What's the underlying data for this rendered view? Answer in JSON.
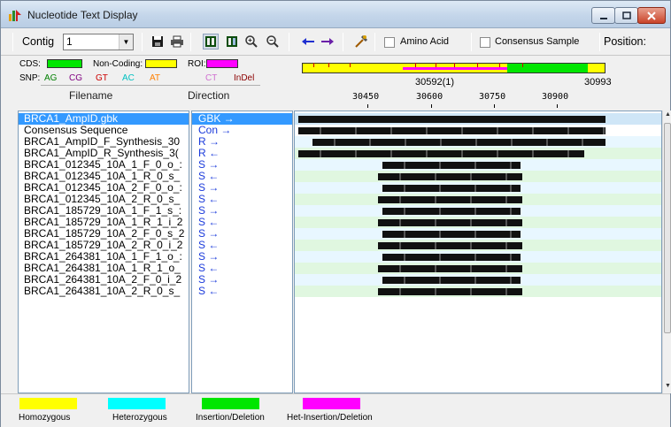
{
  "window": {
    "title": "Nucleotide Text Display"
  },
  "toolbar": {
    "contig_label": "Contig",
    "contig_value": "1",
    "amino_acid_label": "Amino Acid",
    "consensus_sample_label": "Consensus Sample",
    "position_label": "Position:",
    "icons": [
      "save-icon",
      "print-icon",
      "layout-1-icon",
      "layout-2-icon",
      "zoom-in-icon",
      "zoom-out-icon",
      "arrow-left-icon",
      "arrow-right-icon",
      "tools-icon"
    ]
  },
  "legend": {
    "cds_label": "CDS:",
    "noncoding_label": "Non-Coding:",
    "roi_label": "ROI:",
    "snp_label": "SNP:",
    "snp_types": [
      {
        "label": "AG",
        "color": "#008000"
      },
      {
        "label": "CG",
        "color": "#800080"
      },
      {
        "label": "GT",
        "color": "#cc0000"
      },
      {
        "label": "AC",
        "color": "#00c0c0"
      },
      {
        "label": "AT",
        "color": "#ff8000"
      },
      {
        "label": "CT",
        "color": "#d070d0"
      },
      {
        "label": "InDel",
        "color": "#8b0000"
      }
    ],
    "colors": {
      "cds": "#00e600",
      "noncoding": "#ffff00",
      "roi": "#ff00ff"
    }
  },
  "overview": {
    "center_label": "30592(1)",
    "end_label": "30993"
  },
  "columns": {
    "filename": "Filename",
    "direction": "Direction"
  },
  "ruler": [
    "30450",
    "30600",
    "30750",
    "30900"
  ],
  "files": [
    {
      "name": "BRCA1_AmpID.gbk",
      "direction": "GBK  →",
      "selected": true
    },
    {
      "name": "Consensus Sequence",
      "direction": "Con  →"
    },
    {
      "name": "BRCA1_AmpID_F_Synthesis_30",
      "direction": "R   →"
    },
    {
      "name": "BRCA1_AmpID_R_Synthesis_3(",
      "direction": "R   ←"
    },
    {
      "name": "BRCA1_012345_10A_1_F_0_o_:",
      "direction": "S   →"
    },
    {
      "name": "BRCA1_012345_10A_1_R_0_s_",
      "direction": "S   ←"
    },
    {
      "name": "BRCA1_012345_10A_2_F_0_o_:",
      "direction": "S   →"
    },
    {
      "name": "BRCA1_012345_10A_2_R_0_s_",
      "direction": "S   ←"
    },
    {
      "name": "BRCA1_185729_10A_1_F_1_s_:",
      "direction": "S   →"
    },
    {
      "name": "BRCA1_185729_10A_1_R_1_i_2",
      "direction": "S   ←"
    },
    {
      "name": "BRCA1_185729_10A_2_F_0_s_2",
      "direction": "S   →"
    },
    {
      "name": "BRCA1_185729_10A_2_R_0_i_2",
      "direction": "S   ←"
    },
    {
      "name": "BRCA1_264381_10A_1_F_1_o_:",
      "direction": "S   →"
    },
    {
      "name": "BRCA1_264381_10A_1_R_1_o_",
      "direction": "S   ←"
    },
    {
      "name": "BRCA1_264381_10A_2_F_0_i_2",
      "direction": "S   →"
    },
    {
      "name": "BRCA1_264381_10A_2_R_0_s_",
      "direction": "S   ←"
    }
  ],
  "bottom_legend": [
    {
      "label": "Homozygous",
      "color": "#ffff00"
    },
    {
      "label": "Heterozygous",
      "color": "#00ffff"
    },
    {
      "label": "Insertion/Deletion",
      "color": "#00e600"
    },
    {
      "label": "Het-Insertion/Deletion",
      "color": "#ff00ff"
    }
  ]
}
